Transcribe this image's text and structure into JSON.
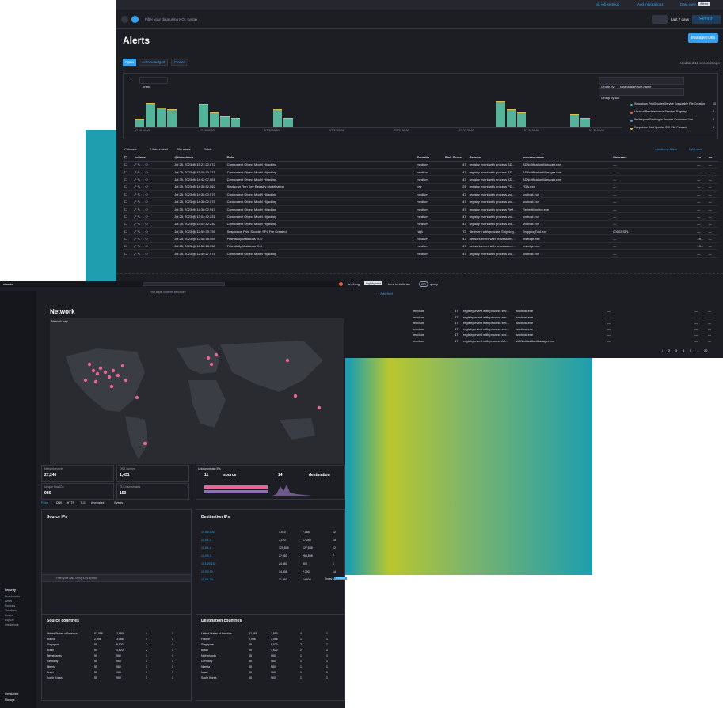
{
  "alerts": {
    "topbar": {
      "ml_job_settings": "ML job settings",
      "add_integrations": "Add integrations",
      "data_view": "Data view",
      "data_view_value": "Alerts"
    },
    "search_placeholder": "Filter your data using KQL syntax",
    "date_range": "Last 7 days",
    "refresh": "Refresh",
    "title": "Alerts",
    "manage_rules": "Manage rules",
    "tabs": [
      "Open",
      "Acknowledged",
      "Closed"
    ],
    "updated": "Updated 11 seconds ago",
    "trend": "Trend",
    "group_by_label": "Group by",
    "group_by_value": "kibana.alert.rule.name",
    "group_by_top": "Group by top",
    "legend": [
      {
        "label": "Suspicious PrintSpooler Service Executable File Creation",
        "count": "10",
        "color": "#54b399"
      },
      {
        "label": "Unusual Persistence via Services Registry",
        "count": "8",
        "color": "#e7664c"
      },
      {
        "label": "Whitespace Padding in Process Command Line",
        "count": "5",
        "color": "#6092c0"
      },
      {
        "label": "Suspicious Print Spooler SPL File Created",
        "count": "4",
        "color": "#d6bf57"
      }
    ],
    "x_ticks": [
      "07-18 00:00",
      "07-19 00:00",
      "07-20 00:00",
      "07-21 00:00",
      "07-22 00:00",
      "07-23 00:00",
      "07-24 00:00",
      "07-25 00:00"
    ],
    "y_ticks": [
      "100",
      "80",
      "60",
      "40",
      "20",
      "0"
    ],
    "toolbar": {
      "columns": "Columns",
      "sorted": "1 field sorted",
      "count": "550 alerts",
      "fields": "Fields",
      "additional_filters": "Additional filters",
      "grid_view": "Grid view"
    },
    "columns": [
      "Actions",
      "@timestamp",
      "Rule",
      "Severity",
      "Risk Score",
      "Reason",
      "process.name",
      "file.name",
      "so",
      "de"
    ],
    "rows": [
      [
        "Jul 25, 2023 @ 15:21:22.872",
        "Component Object Model Hijacking",
        "medium",
        "47",
        "registry event with process AD...",
        "ADNotificationManager.exe",
        "—",
        "—",
        "—"
      ],
      [
        "Jul 25, 2023 @ 15:08:10.371",
        "Component Object Model Hijacking",
        "medium",
        "47",
        "registry event with process AD...",
        "ADNotificationManager.exe",
        "—",
        "—",
        "—"
      ],
      [
        "Jul 25, 2023 @ 14:42:07.061",
        "Component Object Model Hijacking",
        "medium",
        "47",
        "registry event with process AD...",
        "ADNotificationManager.exe",
        "—",
        "—",
        "—"
      ],
      [
        "Jul 25, 2023 @ 14:38:52.062",
        "Startup or Run Key Registry Modification",
        "low",
        "21",
        "registry event with process FD...",
        "FDA.exe",
        "—",
        "—",
        "—"
      ],
      [
        "Jul 25, 2023 @ 14:38:02.579",
        "Component Object Model Hijacking",
        "medium",
        "47",
        "registry event with process svc...",
        "svchost.exe",
        "—",
        "—",
        "—"
      ],
      [
        "Jul 25, 2023 @ 14:38:02.575",
        "Component Object Model Hijacking",
        "medium",
        "47",
        "registry event with process svc...",
        "svchost.exe",
        "—",
        "—",
        "—"
      ],
      [
        "Jul 25, 2023 @ 14:38:02.547",
        "Component Object Model Hijacking",
        "medium",
        "47",
        "registry event with process Refl...",
        "ReflectMonitor.exe",
        "—",
        "—",
        "—"
      ],
      [
        "Jul 25, 2023 @ 13:04:42.231",
        "Component Object Model Hijacking",
        "medium",
        "47",
        "registry event with process svc...",
        "svchost.exe",
        "—",
        "—",
        "—"
      ],
      [
        "Jul 25, 2023 @ 13:04:42.230",
        "Component Object Model Hijacking",
        "medium",
        "47",
        "registry event with process svc...",
        "svchost.exe",
        "—",
        "—",
        "—"
      ],
      [
        "Jul 25, 2023 @ 12:59:39.739",
        "Suspicious Print Spooler SPL File Created",
        "high",
        "73",
        "file event with process Snipping...",
        "SnippingTool.exe",
        "00002.SPL",
        "—",
        "—"
      ],
      [
        "Jul 25, 2023 @ 12:58:18.059",
        "Potentially Malicious TLD",
        "medium",
        "47",
        "network event with process ms...",
        "msedge.exe",
        "—",
        "19...",
        "—"
      ],
      [
        "Jul 25, 2023 @ 12:58:18.058",
        "Potentially Malicious TLD",
        "medium",
        "47",
        "network event with process ms...",
        "msedge.exe",
        "—",
        "19...",
        "—"
      ],
      [
        "Jul 25, 2023 @ 12:49:27.974",
        "Component Object Model Hijacking",
        "medium",
        "47",
        "registry event with process svc...",
        "svchost.exe",
        "—",
        "—",
        "—"
      ]
    ],
    "query_hint": {
      "prefix": "anything",
      "highlighted": "highlighted",
      "middle": "here to build an",
      "or": "OR",
      "suffix": "query",
      "add_field": "+ Add field"
    },
    "rows2": [
      [
        "medium",
        "47",
        "registry event with process svc...",
        "svchost.exe"
      ],
      [
        "medium",
        "47",
        "registry event with process svc...",
        "svchost.exe"
      ],
      [
        "medium",
        "47",
        "registry event with process svc...",
        "svchost.exe"
      ],
      [
        "medium",
        "47",
        "registry event with process svc...",
        "svchost.exe"
      ],
      [
        "medium",
        "47",
        "registry event with process svc...",
        "svchost.exe"
      ],
      [
        "medium",
        "47",
        "registry event with process AD...",
        "ADNotificationManager.exe"
      ]
    ],
    "pagination": [
      "1",
      "2",
      "3",
      "4",
      "5",
      "...",
      "22"
    ]
  },
  "network": {
    "brand": "elastic",
    "search_placeholder": "Find apps, content, and more",
    "title": "Network",
    "map_title": "Network map",
    "sidebar": {
      "section": "Security",
      "items": [
        "Dashboards",
        "Alerts",
        "Findings",
        "Timelines",
        "Cases",
        "Explore",
        "Intelligence"
      ],
      "footer": [
        "Get started",
        "Manage"
      ]
    },
    "stats": [
      {
        "label": "Network events",
        "value": "27,240"
      },
      {
        "label": "DNS queries",
        "value": "1,431"
      },
      {
        "label": "Unique flow IDs",
        "value": "956"
      },
      {
        "label": "TLS handshakes",
        "value": "150"
      }
    ],
    "unique_ips": {
      "label": "Unique private IPs",
      "source_count": "11",
      "source": "source",
      "dest_count": "14",
      "destination": "destination"
    },
    "sub_tabs": [
      "Flows",
      "DNS",
      "HTTP",
      "TLS",
      "Anomalies",
      "Events"
    ],
    "source_ips": "Source IPs",
    "destination_ips": "Destination IPs",
    "source_countries": "Source countries",
    "destination_countries": "Destination countries",
    "dest_ips_rows": [
      {
        "ip": "10.0.0.104",
        "val1": "4,510",
        "val2": "7,168",
        "n": "12"
      },
      {
        "ip": "10.0.1.2",
        "val1": "7,123",
        "val2": "17,288",
        "n": "14"
      },
      {
        "ip": "10.0.1.4",
        "val1": "121,845",
        "val2": "127,888",
        "n": "12"
      },
      {
        "ip": "10.0.0.3",
        "val1": "27,650",
        "val2": "263,898",
        "n": "7"
      },
      {
        "ip": "10.1.20.142",
        "val1": "24,560",
        "val2": "800",
        "n": "1"
      },
      {
        "ip": "10.0.0.10",
        "val1": "14,808",
        "val2": "2,300",
        "n": "14"
      },
      {
        "ip": "10.0.1.33",
        "val1": "31,560",
        "val2": "14,920",
        "n": "5"
      }
    ],
    "countries": [
      {
        "name": "United States of America",
        "a": "67,088",
        "b": "7,580",
        "c": "4",
        "d": "1"
      },
      {
        "name": "France",
        "a": "2,998",
        "b": "3,066",
        "c": "1",
        "d": "1"
      },
      {
        "name": "Singapore",
        "a": "95",
        "b": "8,520",
        "c": "2",
        "d": "1"
      },
      {
        "name": "Brazil",
        "a": "59",
        "b": "3,620",
        "c": "2",
        "d": "1"
      },
      {
        "name": "Netherlands",
        "a": "55",
        "b": "960",
        "c": "1",
        "d": "1"
      },
      {
        "name": "Germany",
        "a": "55",
        "b": "960",
        "c": "1",
        "d": "1"
      },
      {
        "name": "Nigeria",
        "a": "55",
        "b": "960",
        "c": "1",
        "d": "1"
      },
      {
        "name": "Israel",
        "a": "55",
        "b": "960",
        "c": "1",
        "d": "1"
      },
      {
        "name": "South Korea",
        "a": "55",
        "b": "960",
        "c": "1",
        "d": "1"
      }
    ],
    "filter_placeholder": "Filter your data using KQL syntax",
    "today": "Today",
    "refresh": "Refresh"
  }
}
